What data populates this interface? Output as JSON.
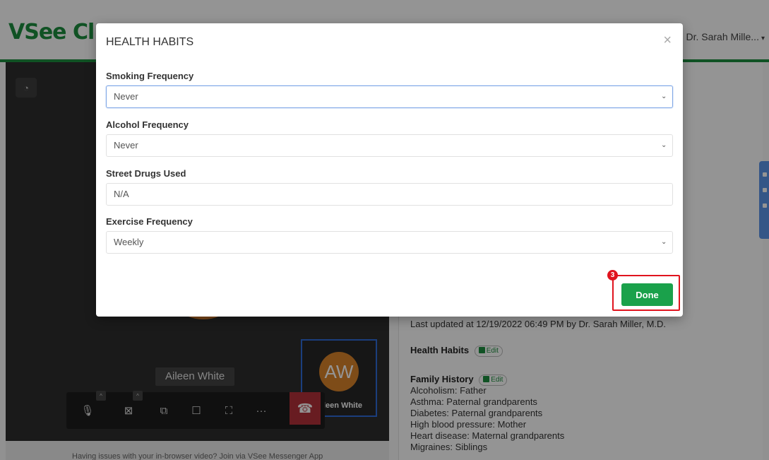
{
  "app": {
    "logo_text": "VSee Cl",
    "user_menu_label": "Dr. Sarah Mille...",
    "user_menu_caret": "▾"
  },
  "video": {
    "gauge_glyph": "◔",
    "participant_name": "Aileen White",
    "self_initials": "AW",
    "self_name": "leen White",
    "help_text": "Having issues with your in-browser video? Join via VSee Messenger App",
    "toolbar": {
      "mic_glyph": "🎙",
      "camera_glyph": "⊠",
      "share_glyph": "⧉",
      "chat_glyph": "☐",
      "fullscreen_glyph": "⛶",
      "more_glyph": "···",
      "end_call_glyph": "☎",
      "caret_glyph": "^"
    }
  },
  "panel": {
    "last_updated": "Last updated at 12/19/2022 06:49 PM by Dr. Sarah Miller, M.D.",
    "health_habits_heading": "Health Habits",
    "family_history_heading": "Family History",
    "edit_label": "Edit",
    "family_history_items": [
      "Alcoholism: Father",
      "Asthma: Paternal grandparents",
      "Diabetes: Paternal grandparents",
      "High blood pressure: Mother",
      "Heart disease: Maternal grandparents",
      "Migraines: Siblings"
    ]
  },
  "modal": {
    "title": "HEALTH HABITS",
    "close_glyph": "×",
    "fields": [
      {
        "label": "Smoking Frequency",
        "value": "Never"
      },
      {
        "label": "Alcohol Frequency",
        "value": "Never"
      },
      {
        "label": "Street Drugs Used",
        "value": "N/A"
      },
      {
        "label": "Exercise Frequency",
        "value": "Weekly"
      }
    ],
    "chevron_glyph": "⌄",
    "done_label": "Done",
    "step_number": "3"
  },
  "colors": {
    "brand_green": "#1c8e3f",
    "done_green": "#1aa14b",
    "highlight_red": "#e0141e",
    "end_call_red": "#b4313a"
  }
}
